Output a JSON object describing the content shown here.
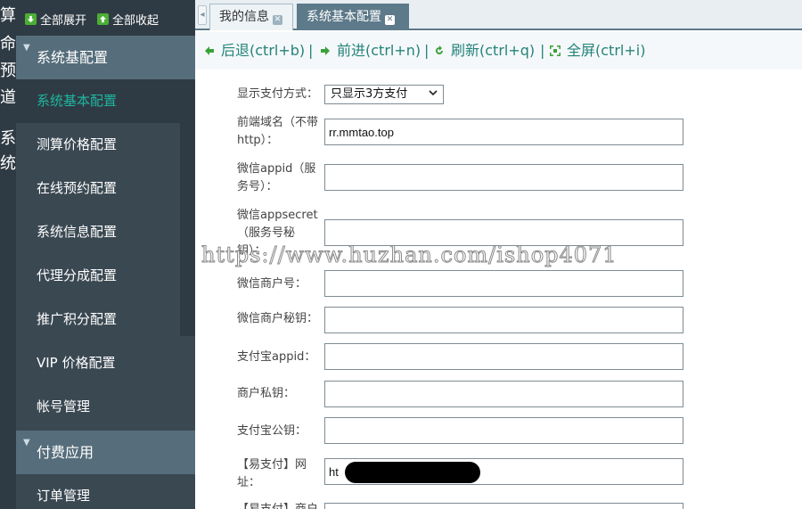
{
  "strip": {
    "chars": [
      "算",
      "命",
      "预",
      "道",
      "系",
      "统"
    ]
  },
  "sidebar": {
    "expand_all": "全部展开",
    "collapse_all": "全部收起",
    "groups": [
      {
        "label": "系统基配置",
        "items": [
          {
            "label": "系统基本配置",
            "active": true
          },
          {
            "label": "测算价格配置"
          },
          {
            "label": "在线预约配置"
          },
          {
            "label": "系统信息配置"
          },
          {
            "label": "代理分成配置"
          },
          {
            "label": "推广积分配置"
          },
          {
            "label": "VIP 价格配置"
          },
          {
            "label": "帐号管理"
          }
        ]
      },
      {
        "label": "付费应用",
        "items": [
          {
            "label": "订单管理"
          }
        ]
      }
    ]
  },
  "tabs": [
    {
      "label": "我的信息",
      "active": false
    },
    {
      "label": "系统基本配置",
      "active": true
    }
  ],
  "toolbar": {
    "back": "后退(ctrl+b)",
    "forward": "前进(ctrl+n)",
    "refresh": "刷新(ctrl+q)",
    "fullscreen": "全屏(ctrl+i)",
    "separator": "|"
  },
  "form": {
    "pay_display": {
      "label": "显示支付方式：",
      "value": "只显示3方支付"
    },
    "domain": {
      "label": "前端域名（不带http）：",
      "value": "rr.mmtao.top"
    },
    "wx_appid": {
      "label": "微信appid（服务号）：",
      "value": ""
    },
    "wx_appsecret": {
      "label": "微信appsecret（服务号秘钥）：",
      "value": ""
    },
    "wx_mch_id": {
      "label": "微信商户号：",
      "value": ""
    },
    "wx_mch_key": {
      "label": "微信商户秘钥：",
      "value": ""
    },
    "ali_appid": {
      "label": "支付宝appid：",
      "value": ""
    },
    "merchant_private_key": {
      "label": "商户私钥：",
      "value": ""
    },
    "ali_public_key": {
      "label": "支付宝公钥：",
      "value": ""
    },
    "yipay_url": {
      "label": "【易支付】网址：",
      "value": "ht"
    },
    "yipay_next": {
      "label": "【易支付】商户"
    }
  },
  "watermark": "https://www.huzhan.com/ishop4071",
  "colors": {
    "sidebar_bg": "#3a4852",
    "group_header": "#566d7b",
    "active_text": "#1fb5a0",
    "toolbar_text": "#24837a"
  }
}
